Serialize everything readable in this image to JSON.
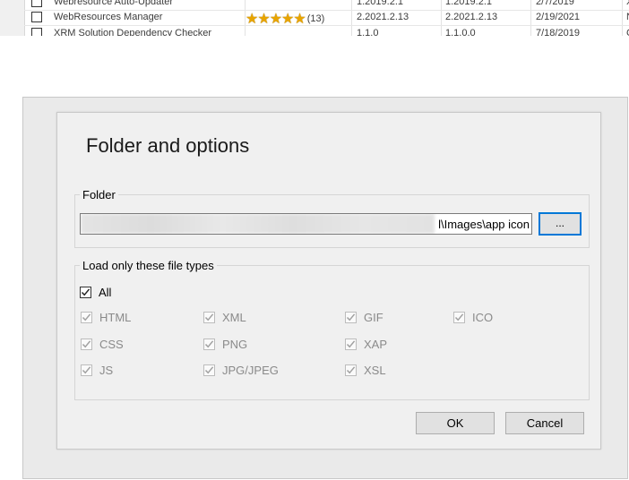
{
  "background_list": {
    "rows": [
      {
        "name": "Webresource Auto-Updater",
        "rating_stars": "",
        "rating_count": "",
        "version": "1.2019.2.1",
        "available": "1.2019.2.1",
        "date": "2/7/2019",
        "extra": "X"
      },
      {
        "name": "WebResources Manager",
        "rating_stars": "★★★★★",
        "rating_count": "(13)",
        "version": "2.2021.2.13",
        "available": "2.2021.2.13",
        "date": "2/19/2021",
        "extra": "N"
      },
      {
        "name": "XRM Solution Dependency Checker",
        "rating_stars": "",
        "rating_count": "",
        "version": "1.1.0",
        "available": "1.1.0.0",
        "date": "7/18/2019",
        "extra": "C"
      }
    ]
  },
  "dialog": {
    "title": "Folder and options",
    "folder_group": {
      "legend": "Folder",
      "path_value": "l\\Images\\app icon",
      "browse_label": "..."
    },
    "types_group": {
      "legend": "Load only these file types",
      "all_label": "All",
      "all_checked": true,
      "types": [
        {
          "label": "HTML",
          "checked": true
        },
        {
          "label": "XML",
          "checked": true
        },
        {
          "label": "GIF",
          "checked": true
        },
        {
          "label": "ICO",
          "checked": true
        },
        {
          "label": "CSS",
          "checked": true
        },
        {
          "label": "PNG",
          "checked": true
        },
        {
          "label": "XAP",
          "checked": true
        },
        {
          "label": "JS",
          "checked": true
        },
        {
          "label": "JPG/JPEG",
          "checked": true
        },
        {
          "label": "XSL",
          "checked": true
        }
      ]
    },
    "ok_label": "OK",
    "cancel_label": "Cancel"
  },
  "colors": {
    "focus_border": "#0078d7",
    "star": "#e8a400",
    "disabled_text": "#8a8a8a"
  }
}
